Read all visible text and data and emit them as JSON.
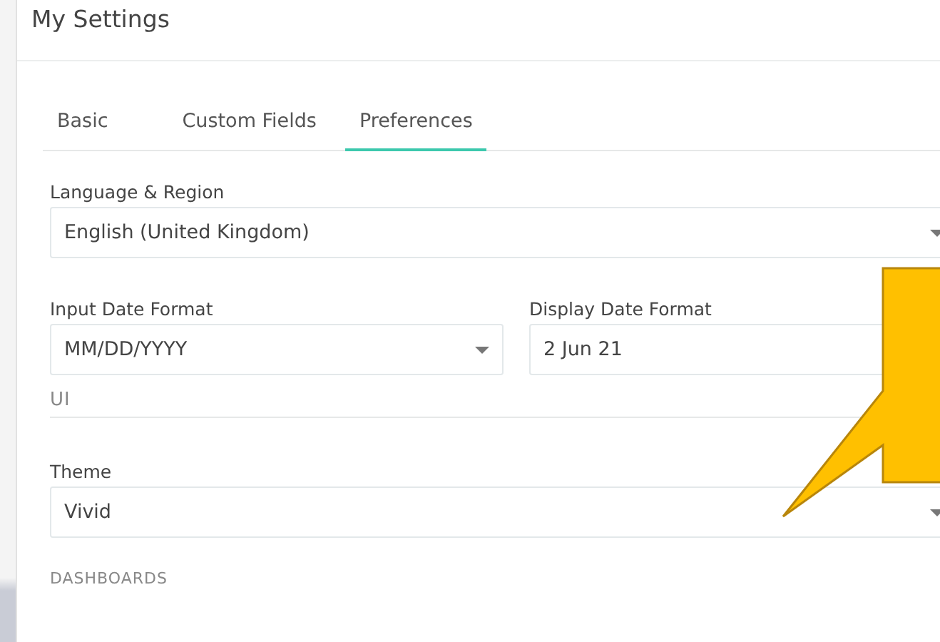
{
  "window": {
    "title": "My Settings"
  },
  "tabs": [
    {
      "label": "Basic",
      "selected": false
    },
    {
      "label": "Custom Fields",
      "selected": false
    },
    {
      "label": "Preferences",
      "selected": true
    }
  ],
  "language": {
    "label": "Language & Region",
    "value": "English (United Kingdom)"
  },
  "date_formats": [
    {
      "label": "Input Date Format",
      "value": "MM/DD/YYYY"
    },
    {
      "label": "Display Date Format",
      "value": "2 Jun 21"
    }
  ],
  "ui_section": {
    "heading": "UI",
    "theme": {
      "label": "Theme",
      "value": "Vivid"
    }
  },
  "next_section": {
    "heading": "DASHBOARDS"
  }
}
